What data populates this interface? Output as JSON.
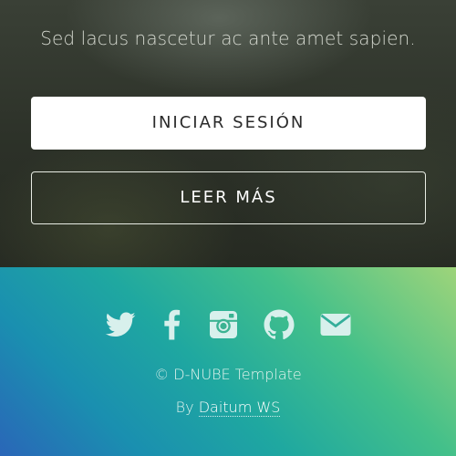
{
  "hero": {
    "tagline": "Sed lacus nascetur ac ante amet sapien.",
    "primary_button": "INICIAR SESIÓN",
    "secondary_button": "LEER MÁS"
  },
  "footer": {
    "social": [
      {
        "icon": "twitter-icon"
      },
      {
        "icon": "facebook-icon"
      },
      {
        "icon": "instagram-icon"
      },
      {
        "icon": "github-icon"
      },
      {
        "icon": "email-icon"
      }
    ],
    "copyright": "© D-NUBE Template",
    "by_prefix": "By",
    "author": "Daitum WS"
  },
  "colors": {
    "hero_bg": "#2c3128",
    "icon_color": "#d8f0ec",
    "footer_gradient_start": "#9ed47a",
    "footer_gradient_end": "#2a66b8"
  }
}
